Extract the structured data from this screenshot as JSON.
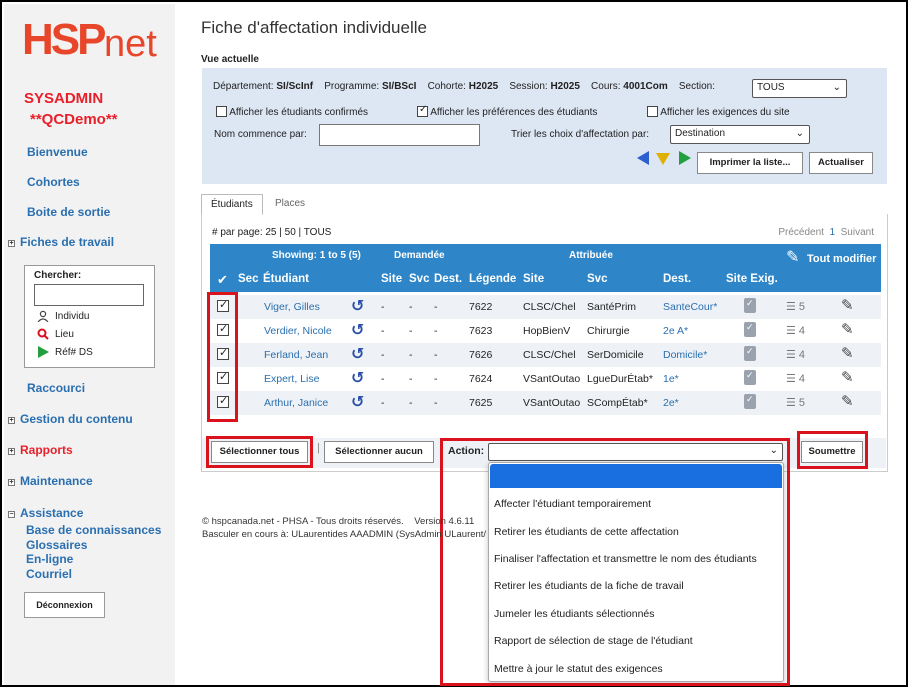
{
  "sidebar": {
    "logo_hsp": "HSP",
    "logo_net": "net",
    "user": "SYSADMIN",
    "demo": "**QCDemo**",
    "links": {
      "bienvenue": "Bienvenue",
      "cohortes": "Cohortes",
      "boite": "Boite de sortie",
      "fiches": "Fiches de travail",
      "raccourci": "Raccourci",
      "gestion": "Gestion du contenu",
      "rapports": "Rapports",
      "maintenance": "Maintenance",
      "assistance": "Assistance",
      "base": "Base de connaissances",
      "glossaires": "Glossaires",
      "enligne": "En-ligne",
      "courriel": "Courriel"
    },
    "search": {
      "label": "Chercher:",
      "individu": "Individu",
      "lieu": "Lieu",
      "ref": "Réf# DS"
    },
    "logout": "Déconnexion"
  },
  "page": {
    "title": "Fiche d'affectation individuelle",
    "vue": "Vue actuelle"
  },
  "filters": {
    "dept_label": "Département:",
    "dept_value": "SI/ScInf",
    "prog_label": "Programme:",
    "prog_value": "SI/BScI",
    "cohorte_label": "Cohorte:",
    "cohorte_value": "H2025",
    "session_label": "Session:",
    "session_value": "H2025",
    "cours_label": "Cours:",
    "cours_value": "4001Com",
    "section_label": "Section:",
    "section_value": "TOUS",
    "chk_confirmes": "Afficher les étudiants confirmés",
    "chk_preferences": "Afficher les préférences des étudiants",
    "chk_exigences": "Afficher les exigences du site",
    "nom_label": "Nom commence par:",
    "trier_label": "Trier les choix d'affectation par:",
    "trier_value": "Destination",
    "print_btn": "Imprimer la liste...",
    "refresh_btn": "Actualiser"
  },
  "tabs": [
    "Étudiants",
    "Places"
  ],
  "paging": {
    "per_page": "# par page: 25 | 50 | TOUS",
    "prev": "Précédent",
    "current": "1",
    "next": "Suivant"
  },
  "table": {
    "showing": "Showing: 1 to 5 (5)",
    "demandee": "Demandée",
    "attribuee": "Attribuée",
    "tout_modifier": "Tout modifier",
    "headers": {
      "check": "✔",
      "sec": "Sec",
      "etudiant": "Étudiant",
      "site_d": "Site",
      "svc_d": "Svc",
      "dest_d": "Dest.",
      "legende": "Légende",
      "site_a": "Site",
      "svc_a": "Svc",
      "dest_a": "Dest.",
      "site_exig": "Site Exig."
    },
    "rows": [
      {
        "name": "Viger, Gilles",
        "site": "-",
        "svc": "-",
        "dest": "-",
        "legende": "7622",
        "site_a": "CLSC/Chel",
        "svc_a": "SantéPrim",
        "dest_a": "SanteCour*",
        "count": "5"
      },
      {
        "name": "Verdier, Nicole",
        "site": "-",
        "svc": "-",
        "dest": "-",
        "legende": "7623",
        "site_a": "HopBienV",
        "svc_a": "Chirurgie",
        "dest_a": "2e A*",
        "count": "4"
      },
      {
        "name": "Ferland, Jean",
        "site": "-",
        "svc": "-",
        "dest": "-",
        "legende": "7626",
        "site_a": "CLSC/Chel",
        "svc_a": "SerDomicile",
        "dest_a": "Domicile*",
        "count": "4"
      },
      {
        "name": "Expert, Lise",
        "site": "-",
        "svc": "-",
        "dest": "-",
        "legende": "7624",
        "site_a": "VSantOutao",
        "svc_a": "LgueDurÉtab*",
        "dest_a": "1e*",
        "count": "4"
      },
      {
        "name": "Arthur, Janice",
        "site": "-",
        "svc": "-",
        "dest": "-",
        "legende": "7625",
        "site_a": "VSantOutao",
        "svc_a": "SCompÉtab*",
        "dest_a": "2e*",
        "count": "5"
      }
    ]
  },
  "actions": {
    "select_all": "Sélectionner tous",
    "select_none": "Sélectionner aucun",
    "action_label": "Action:",
    "submit": "Soumettre",
    "options": [
      "",
      "Affecter l'étudiant temporairement",
      "Retirer les étudiants de cette affectation",
      "Finaliser l'affectation et transmettre le nom des étudiants",
      "Retirer les étudiants de la fiche de travail",
      "Jumeler les étudiants sélectionnés",
      "Rapport de sélection de stage de l'étudiant",
      "Mettre à jour le statut des exigences"
    ]
  },
  "footer": {
    "line1": "© hspcanada.net - PHSA - Tous droits réservés.",
    "version": "Version 4.6.11",
    "line2": "Basculer en cours à: ULaurentides AAADMIN (SysAdmin ULaurent/"
  },
  "colors": {
    "brand": "#e8462a",
    "accent": "#2e86c8",
    "highlight": "#d9121e",
    "dropdown_selected": "#1a6fe0"
  }
}
